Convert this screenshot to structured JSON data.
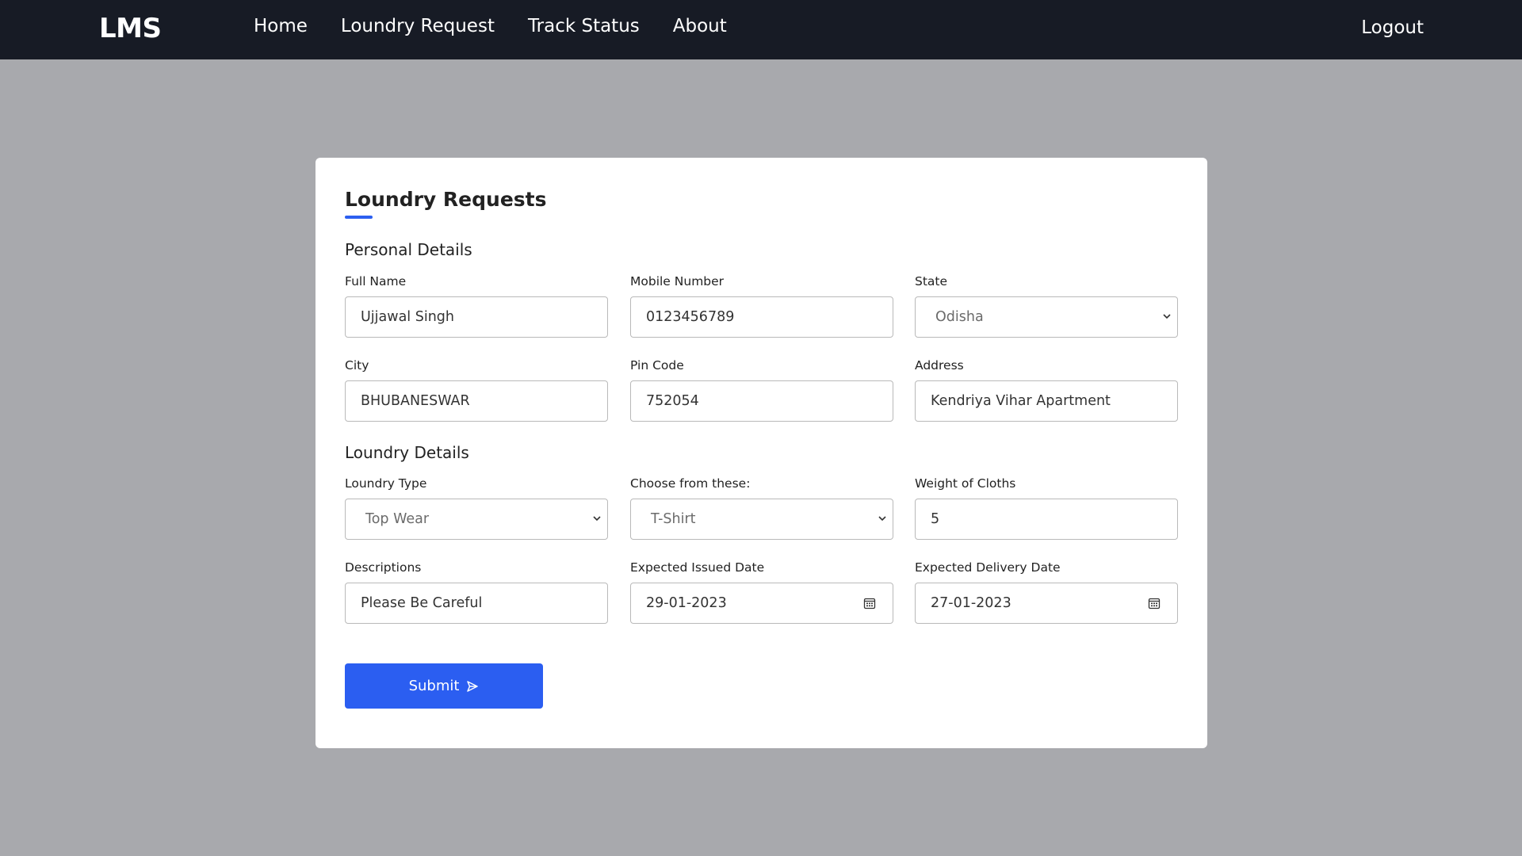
{
  "nav": {
    "brand": "LMS",
    "links": [
      "Home",
      "Loundry Request",
      "Track Status",
      "About"
    ],
    "logout": "Logout"
  },
  "form": {
    "title": "Loundry Requests",
    "personal_section": "Personal Details",
    "laundry_section": "Loundry Details",
    "fields": {
      "full_name": {
        "label": "Full Name",
        "value": "Ujjawal Singh"
      },
      "mobile": {
        "label": "Mobile Number",
        "value": "0123456789"
      },
      "state": {
        "label": "State",
        "value": "Odisha"
      },
      "city": {
        "label": "City",
        "value": "BHUBANESWAR"
      },
      "pin": {
        "label": "Pin Code",
        "value": "752054"
      },
      "address": {
        "label": "Address",
        "value": "Kendriya Vihar Apartment"
      },
      "laundry_type": {
        "label": "Loundry Type",
        "value": "Top Wear"
      },
      "choose": {
        "label": "Choose from these:",
        "value": "T-Shirt"
      },
      "weight": {
        "label": "Weight of Cloths",
        "value": "5"
      },
      "description": {
        "label": "Descriptions",
        "value": "Please Be Careful"
      },
      "issued_date": {
        "label": "Expected Issued Date",
        "value": "29-01-2023"
      },
      "delivery_date": {
        "label": "Expected Delivery Date",
        "value": "27-01-2023"
      }
    },
    "submit": "Submit",
    "colors": {
      "accent": "#2b5ef1",
      "navbar": "#171b25",
      "page_bg": "#a8a9ad"
    }
  }
}
